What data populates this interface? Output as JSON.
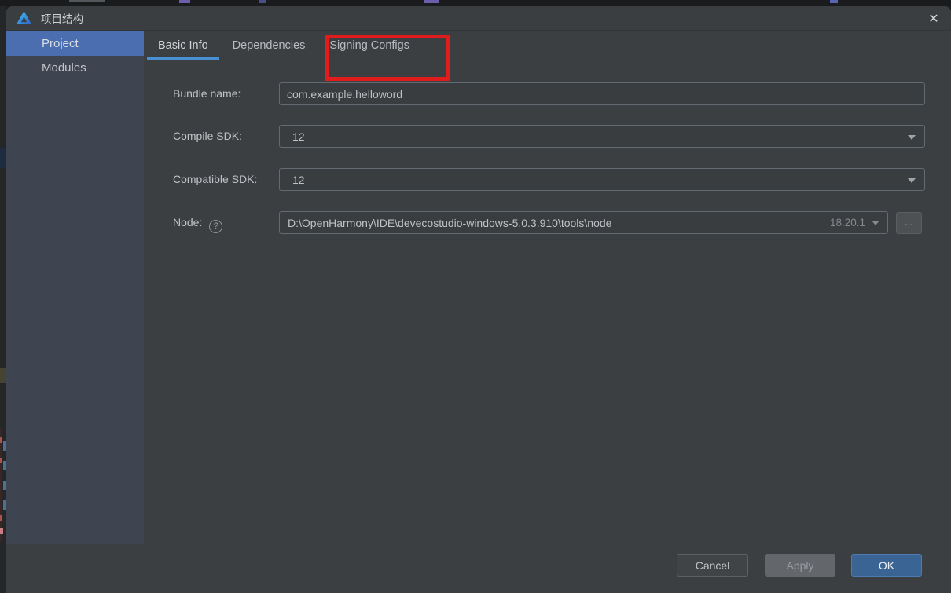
{
  "window": {
    "title": "项目结构",
    "close_glyph": "✕"
  },
  "sidebar": {
    "project": "Project",
    "modules": "Modules"
  },
  "tabs": {
    "basic_info": "Basic Info",
    "dependencies": "Dependencies",
    "signing_configs": "Signing Configs"
  },
  "annotation": {
    "shape": "rectangle",
    "color": "#e11c1c",
    "target_tab": "Signing Configs"
  },
  "form": {
    "bundle": {
      "label": "Bundle name:",
      "value": "com.example.helloword"
    },
    "compile_sdk": {
      "label": "Compile SDK:",
      "value": "12"
    },
    "compatible_sdk": {
      "label": "Compatible SDK:",
      "value": "12"
    },
    "node": {
      "label": "Node:",
      "help_glyph": "?",
      "value": "D:\\OpenHarmony\\IDE\\devecostudio-windows-5.0.3.910\\tools\\node",
      "version": "18.20.1",
      "browse": "..."
    }
  },
  "footer": {
    "cancel": "Cancel",
    "apply": "Apply",
    "ok": "OK"
  },
  "colors": {
    "panel_bg": "#3c3f41",
    "sidebar_bg": "#3e4450",
    "selection_blue": "#4a6eb0",
    "tab_underline": "#4a8fd4",
    "ok_blue": "#3a6493",
    "annotation_red": "#e11c1c"
  }
}
